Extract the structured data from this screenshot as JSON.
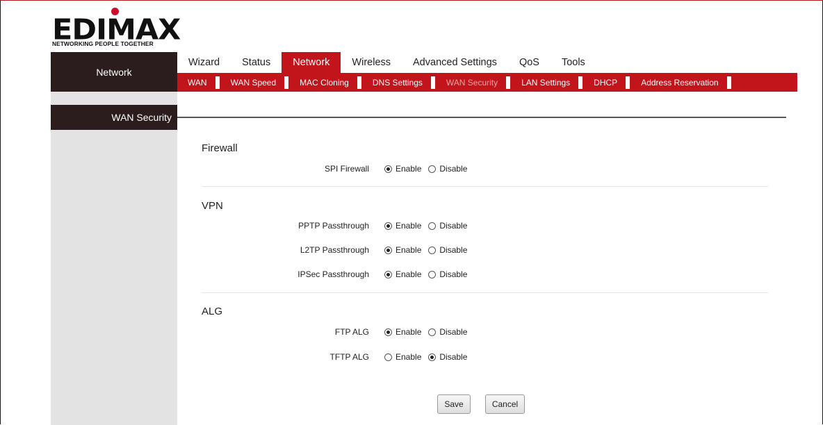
{
  "logo": {
    "wordmark": "EDIMAX",
    "tagline": "NETWORKING PEOPLE TOGETHER"
  },
  "left_nav": {
    "header": "Network",
    "items": [
      {
        "label": "WAN Security"
      }
    ]
  },
  "top_tabs": [
    {
      "label": "Wizard",
      "active": false
    },
    {
      "label": "Status",
      "active": false
    },
    {
      "label": "Network",
      "active": true
    },
    {
      "label": "Wireless",
      "active": false
    },
    {
      "label": "Advanced Settings",
      "active": false
    },
    {
      "label": "QoS",
      "active": false
    },
    {
      "label": "Tools",
      "active": false
    }
  ],
  "sub_nav": [
    {
      "label": "WAN",
      "active": false
    },
    {
      "label": "WAN Speed",
      "active": false
    },
    {
      "label": "MAC Cloning",
      "active": false
    },
    {
      "label": "DNS Settings",
      "active": false
    },
    {
      "label": "WAN Security",
      "active": true
    },
    {
      "label": "LAN Settings",
      "active": false
    },
    {
      "label": "DHCP",
      "active": false
    },
    {
      "label": "Address Reservation",
      "active": false
    }
  ],
  "sections": [
    {
      "title": "Firewall",
      "rows": [
        {
          "label": "SPI Firewall",
          "value": "Enable"
        }
      ]
    },
    {
      "title": "VPN",
      "rows": [
        {
          "label": "PPTP Passthrough",
          "value": "Enable"
        },
        {
          "label": "L2TP Passthrough",
          "value": "Enable"
        },
        {
          "label": "IPSec Passthrough",
          "value": "Enable"
        }
      ]
    },
    {
      "title": "ALG",
      "rows": [
        {
          "label": "FTP ALG",
          "value": "Enable"
        },
        {
          "label": "TFTP ALG",
          "value": "Disable"
        }
      ]
    }
  ],
  "options": {
    "enable": "Enable",
    "disable": "Disable"
  },
  "buttons": {
    "save": "Save",
    "cancel": "Cancel"
  },
  "colors": {
    "brand_red": "#c1141b",
    "dark_nav": "#2b1d1d",
    "sidebar_gray": "#e3e3e3"
  }
}
